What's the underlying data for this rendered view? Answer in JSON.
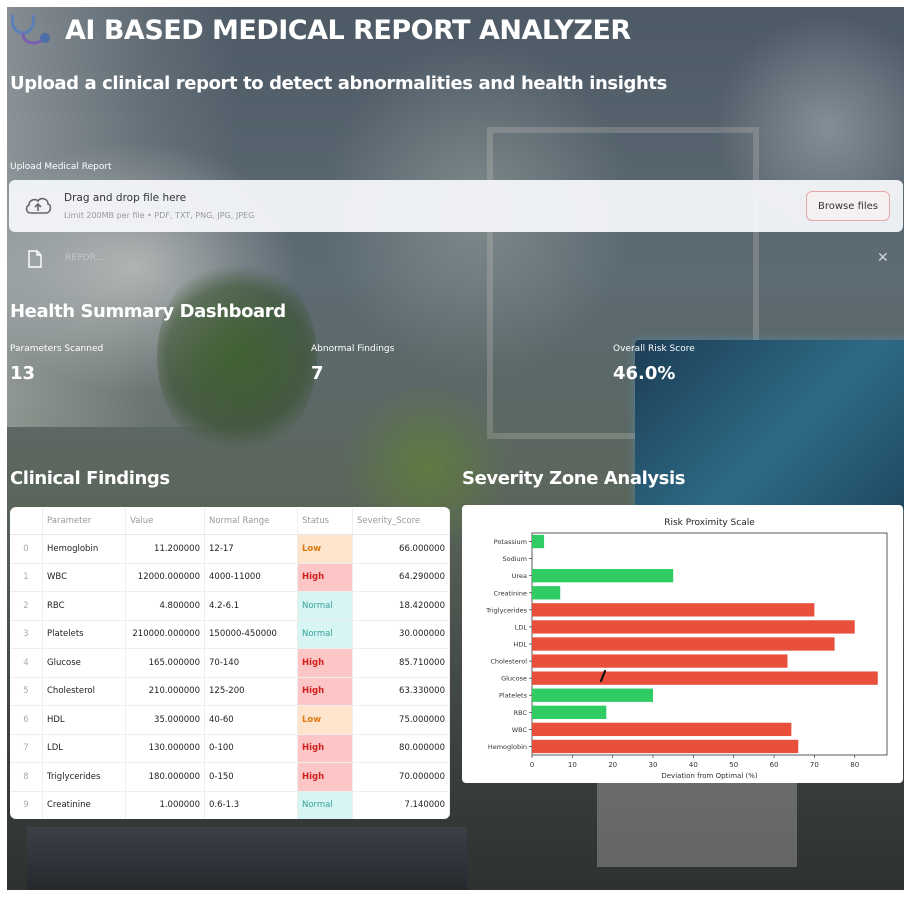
{
  "header": {
    "title": "AI BASED MEDICAL REPORT ANALYZER",
    "subtitle": "Upload a clinical report to detect abnormalities and health insights"
  },
  "upload": {
    "label": "Upload Medical Report",
    "drag_text": "Drag and drop file here",
    "limit_text": "Limit 200MB per file • PDF, TXT, PNG, JPG, JPEG",
    "browse_label": "Browse files",
    "file_name": "REPOR...",
    "remove_glyph": "✕"
  },
  "dashboard": {
    "title": "Health Summary Dashboard",
    "metrics": [
      {
        "label": "Parameters Scanned",
        "value": "13"
      },
      {
        "label": "Abnormal Findings",
        "value": "7"
      },
      {
        "label": "Overall Risk Score",
        "value": "46.0%"
      }
    ]
  },
  "findings": {
    "title": "Clinical Findings",
    "columns": [
      "",
      "Parameter",
      "Value",
      "Normal Range",
      "Status",
      "Severity_Score"
    ],
    "rows": [
      [
        "0",
        "Hemoglobin",
        "11.200000",
        "12-17",
        "Low",
        "66.000000"
      ],
      [
        "1",
        "WBC",
        "12000.000000",
        "4000-11000",
        "High",
        "64.290000"
      ],
      [
        "2",
        "RBC",
        "4.800000",
        "4.2-6.1",
        "Normal",
        "18.420000"
      ],
      [
        "3",
        "Platelets",
        "210000.000000",
        "150000-450000",
        "Normal",
        "30.000000"
      ],
      [
        "4",
        "Glucose",
        "165.000000",
        "70-140",
        "High",
        "85.710000"
      ],
      [
        "5",
        "Cholesterol",
        "210.000000",
        "125-200",
        "High",
        "63.330000"
      ],
      [
        "6",
        "HDL",
        "35.000000",
        "40-60",
        "Low",
        "75.000000"
      ],
      [
        "7",
        "LDL",
        "130.000000",
        "0-100",
        "High",
        "80.000000"
      ],
      [
        "8",
        "Triglycerides",
        "180.000000",
        "0-150",
        "High",
        "70.000000"
      ],
      [
        "9",
        "Creatinine",
        "1.000000",
        "0.6-1.3",
        "Normal",
        "7.140000"
      ]
    ]
  },
  "severity": {
    "title": "Severity Zone Analysis"
  },
  "colors": {
    "abnormal": "#e8503c",
    "normal": "#2ecc62",
    "status_low_bg": "#fde5cd",
    "status_high_bg": "#fcc6c6",
    "status_normal_bg": "#d7f5f2"
  },
  "chart_data": {
    "type": "bar",
    "orientation": "horizontal",
    "title": "Risk Proximity Scale",
    "xlabel": "Deviation from Optimal (%)",
    "ylabel": "",
    "xlim": [
      0,
      88
    ],
    "xticks": [
      0,
      10,
      20,
      30,
      40,
      50,
      60,
      70,
      80
    ],
    "categories": [
      "Potassium",
      "Sodium",
      "Urea",
      "Creatinine",
      "Triglycerides",
      "LDL",
      "HDL",
      "Cholesterol",
      "Glucose",
      "Platelets",
      "RBC",
      "WBC",
      "Hemoglobin"
    ],
    "values": [
      3,
      0,
      35,
      7,
      70,
      80,
      75,
      63.33,
      85.71,
      30,
      18.42,
      64.29,
      66
    ],
    "status": [
      "normal",
      "normal",
      "normal",
      "normal",
      "abnormal",
      "abnormal",
      "abnormal",
      "abnormal",
      "abnormal",
      "normal",
      "normal",
      "abnormal",
      "abnormal"
    ],
    "grid": false,
    "legend": "none"
  }
}
